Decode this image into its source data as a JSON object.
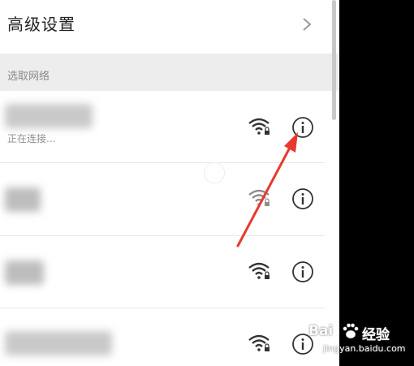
{
  "advanced": {
    "title": "高级设置",
    "icon": "chevron-right-icon"
  },
  "section": {
    "label": "选取网络"
  },
  "networks": [
    {
      "status": "正在连接...",
      "signal_icon": "wifi-locked-icon",
      "info_icon": "info-icon",
      "name_obscured": true
    },
    {
      "status": "",
      "signal_icon": "wifi-locked-icon",
      "info_icon": "info-icon",
      "name_obscured": true
    },
    {
      "status": "",
      "signal_icon": "wifi-locked-icon",
      "info_icon": "info-icon",
      "name_obscured": true
    },
    {
      "status": "",
      "signal_icon": "wifi-locked-icon",
      "info_icon": "info-icon",
      "name_obscured": true
    }
  ],
  "annotation": {
    "color": "#e8392f",
    "target": "info-button"
  },
  "watermark": {
    "logo": "Bai",
    "brand": "经验",
    "url": "jingyan.baidu.com"
  },
  "colors": {
    "text": "#222222",
    "muted": "#8a8a8a",
    "section_bg": "#ededed",
    "icon": "#333333"
  }
}
